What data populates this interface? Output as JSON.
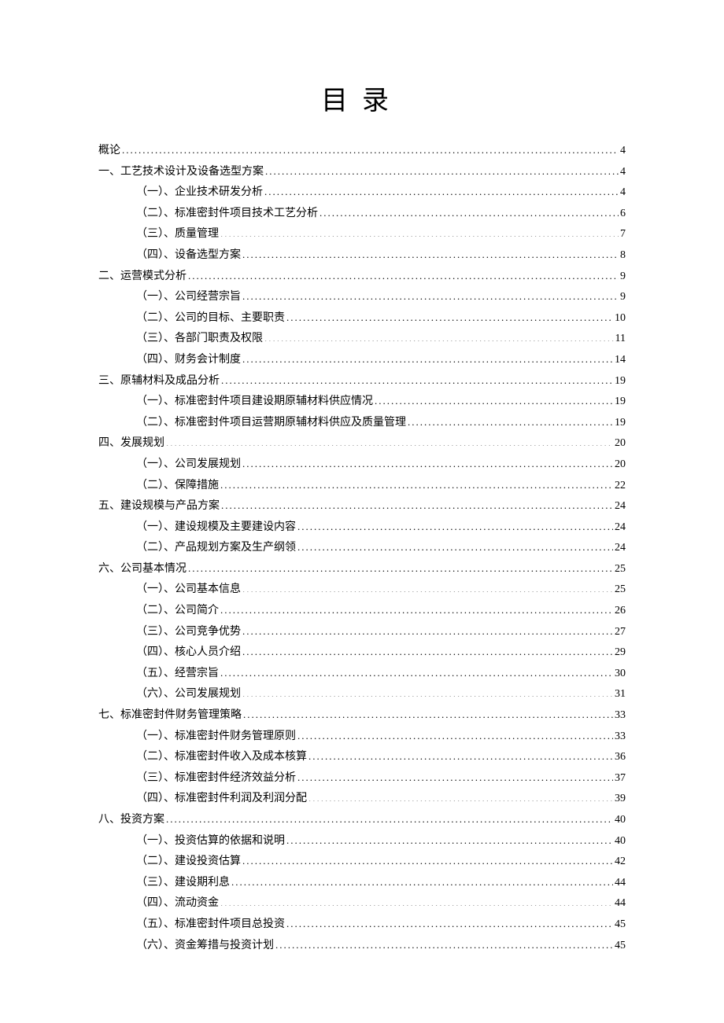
{
  "title": "目录",
  "toc": [
    {
      "level": 0,
      "label": "概论",
      "page": "4"
    },
    {
      "level": 0,
      "label": "一、工艺技术设计及设备选型方案",
      "page": "4"
    },
    {
      "level": 1,
      "label": "（一）、企业技术研发分析",
      "page": "4"
    },
    {
      "level": 1,
      "label": "（二）、标准密封件项目技术工艺分析",
      "page": "6"
    },
    {
      "level": 1,
      "label": "（三）、质量管理",
      "page": "7"
    },
    {
      "level": 1,
      "label": "（四）、设备选型方案",
      "page": "8"
    },
    {
      "level": 0,
      "label": "二、运营模式分析",
      "page": "9"
    },
    {
      "level": 1,
      "label": "（一）、公司经营宗旨",
      "page": "9"
    },
    {
      "level": 1,
      "label": "（二）、公司的目标、主要职责",
      "page": "10"
    },
    {
      "level": 1,
      "label": "（三）、各部门职责及权限",
      "page": "11"
    },
    {
      "level": 1,
      "label": "（四）、财务会计制度",
      "page": "14"
    },
    {
      "level": 0,
      "label": "三、原辅材料及成品分析",
      "page": "19"
    },
    {
      "level": 1,
      "label": "（一）、标准密封件项目建设期原辅材料供应情况",
      "page": "19"
    },
    {
      "level": 1,
      "label": "（二）、标准密封件项目运营期原辅材料供应及质量管理",
      "page": "19"
    },
    {
      "level": 0,
      "label": "四、发展规划",
      "page": "20"
    },
    {
      "level": 1,
      "label": "（一）、公司发展规划",
      "page": "20"
    },
    {
      "level": 1,
      "label": "（二）、保障措施",
      "page": "22"
    },
    {
      "level": 0,
      "label": "五、建设规模与产品方案",
      "page": "24"
    },
    {
      "level": 1,
      "label": "（一）、建设规模及主要建设内容",
      "page": "24"
    },
    {
      "level": 1,
      "label": "（二）、产品规划方案及生产纲领",
      "page": "24"
    },
    {
      "level": 0,
      "label": "六、公司基本情况",
      "page": "25"
    },
    {
      "level": 1,
      "label": "（一）、公司基本信息",
      "page": "25"
    },
    {
      "level": 1,
      "label": "（二）、公司简介",
      "page": "26"
    },
    {
      "level": 1,
      "label": "（三）、公司竞争优势",
      "page": "27"
    },
    {
      "level": 1,
      "label": "（四）、核心人员介绍",
      "page": "29"
    },
    {
      "level": 1,
      "label": "（五）、经营宗旨",
      "page": "30"
    },
    {
      "level": 1,
      "label": "（六）、公司发展规划",
      "page": "31"
    },
    {
      "level": 0,
      "label": "七、标准密封件财务管理策略",
      "page": "33"
    },
    {
      "level": 1,
      "label": "（一）、标准密封件财务管理原则",
      "page": "33"
    },
    {
      "level": 1,
      "label": "（二）、标准密封件收入及成本核算",
      "page": "36"
    },
    {
      "level": 1,
      "label": "（三）、标准密封件经济效益分析",
      "page": "37"
    },
    {
      "level": 1,
      "label": "（四）、标准密封件利润及利润分配",
      "page": "39"
    },
    {
      "level": 0,
      "label": "八、投资方案",
      "page": "40"
    },
    {
      "level": 1,
      "label": "（一）、投资估算的依据和说明",
      "page": "40"
    },
    {
      "level": 1,
      "label": "（二）、建设投资估算",
      "page": "42"
    },
    {
      "level": 1,
      "label": "（三）、建设期利息",
      "page": "44"
    },
    {
      "level": 1,
      "label": "（四）、流动资金",
      "page": "44"
    },
    {
      "level": 1,
      "label": "（五）、标准密封件项目总投资",
      "page": "45"
    },
    {
      "level": 1,
      "label": "（六）、资金筹措与投资计划",
      "page": "45"
    }
  ]
}
